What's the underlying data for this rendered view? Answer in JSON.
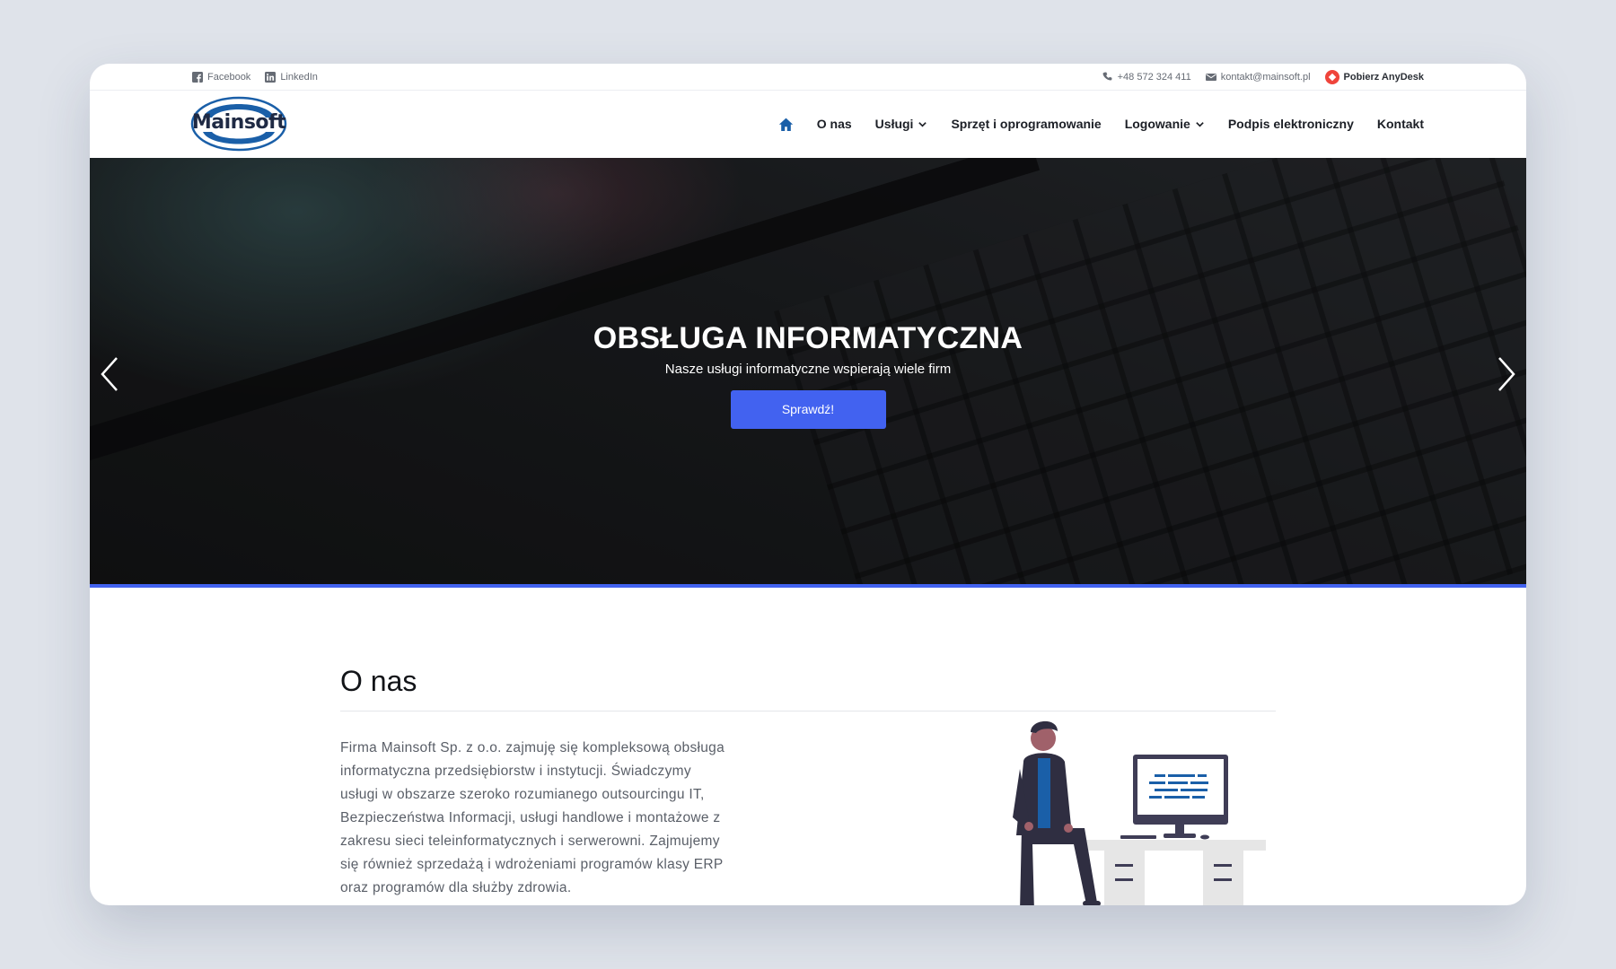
{
  "topbar": {
    "social": [
      {
        "label": "Facebook",
        "icon": "facebook-icon"
      },
      {
        "label": "LinkedIn",
        "icon": "linkedin-icon"
      }
    ],
    "phone": "+48 572 324 411",
    "email": "kontakt@mainsoft.pl",
    "anydesk": "Pobierz AnyDesk"
  },
  "brand": {
    "name": "Mainsoft",
    "color": "#1a5fa8"
  },
  "nav": {
    "items": [
      {
        "label": "O nas"
      },
      {
        "label": "Usługi",
        "dropdown": true
      },
      {
        "label": "Sprzęt i oprogramowanie"
      },
      {
        "label": "Logowanie",
        "dropdown": true
      },
      {
        "label": "Podpis elektroniczny"
      },
      {
        "label": "Kontakt"
      }
    ]
  },
  "hero": {
    "title": "OBSŁUGA INFORMATYCZNA",
    "subtitle": "Nasze usługi informatyczne wspierają wiele firm",
    "button": "Sprawdź!",
    "accent": "#4262f0"
  },
  "about": {
    "title": "O nas",
    "text": "Firma Mainsoft Sp. z o.o. zajmuję się kompleksową obsługa informatyczna przedsiębiorstw i instytucji. Świadczymy usługi w obszarze szeroko rozumianego outsourcingu IT, Bezpieczeństwa Informacji, usługi handlowe i montażowe z zakresu sieci teleinformatycznych i serwerowni. Zajmujemy się również sprzedażą i wdrożeniami programów klasy ERP oraz programów dla służby zdrowia."
  }
}
